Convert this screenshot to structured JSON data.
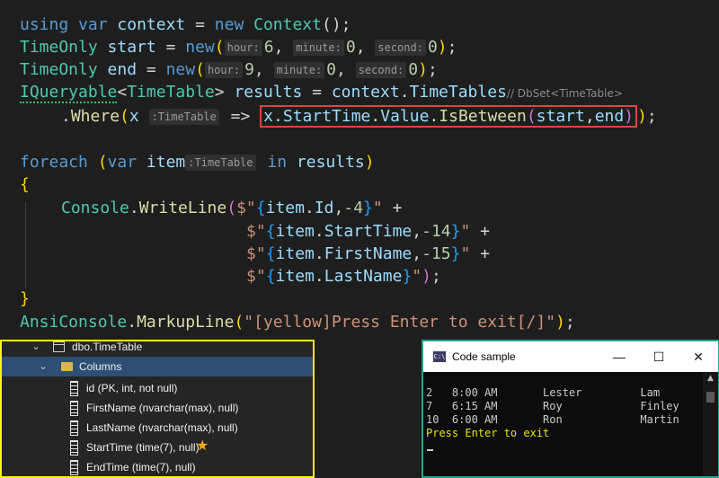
{
  "editor": {
    "l1": {
      "using": "using",
      "var": "var",
      "context": "context",
      "eq": " = ",
      "new": "new",
      "type": "Context",
      "tail": "();"
    },
    "l2": {
      "type": "TimeOnly",
      "name": "start",
      "eq": " = ",
      "new": "new",
      "open": "(",
      "h1": "hour:",
      "v1": "6",
      "comma1": ", ",
      "h2": "minute:",
      "v2": "0",
      "comma2": ", ",
      "h3": "second:",
      "v3": "0",
      "close": ")",
      "semi": ";"
    },
    "l3": {
      "type": "TimeOnly",
      "name": "end",
      "eq": " = ",
      "new": "new",
      "open": "(",
      "h1": "hour:",
      "v1": "9",
      "comma1": ", ",
      "h2": "minute:",
      "v2": "0",
      "comma2": ", ",
      "h3": "second:",
      "v3": "0",
      "close": ")",
      "semi": ";"
    },
    "l4": {
      "type": "IQueryable",
      "lt": "<",
      "gen": "TimeTable",
      "gt": ">",
      "name": "results",
      "eq": " = ",
      "ctx": "context",
      "dot": ".",
      "prop": "TimeTables",
      "comment": "// DbSet<TimeTable>"
    },
    "l5": {
      "dot": ".",
      "where": "Where",
      "open": "(",
      "x": "x",
      "hint": ":TimeTable",
      "arrow": " => ",
      "boxed_x": "x",
      "d1": ".",
      "startTime": "StartTime",
      "d2": ".",
      "value": "Value",
      "d3": ".",
      "isBetween": "IsBetween",
      "o2": "(",
      "a1": "start",
      "comma": ",",
      "a2": "end",
      "c2": ")",
      "close": ")",
      "semi": ";"
    },
    "l7": {
      "foreach": "foreach",
      "open": "(",
      "var": "var",
      "item": "item",
      "hint": ":TimeTable",
      "in": "in",
      "results": "results",
      "close": ")"
    },
    "l8": {
      "brace": "{"
    },
    "l9": {
      "console": "Console",
      "dot": ".",
      "writeLine": "WriteLine",
      "open": "(",
      "str1": "$\"",
      "ob": "{",
      "item": "item",
      "d": ".",
      "prop": "Id",
      "c": ",",
      "n": "-4",
      "cb": "}",
      "str2": "\"",
      "plus": " +"
    },
    "l10": {
      "str1": "$\"",
      "ob": "{",
      "item": "item",
      "d": ".",
      "prop": "StartTime",
      "c": ",",
      "n": "-14",
      "cb": "}",
      "str2": "\"",
      "plus": " +"
    },
    "l11": {
      "str1": "$\"",
      "ob": "{",
      "item": "item",
      "d": ".",
      "prop": "FirstName",
      "c": ",",
      "n": "-15",
      "cb": "}",
      "str2": "\"",
      "plus": " +"
    },
    "l12": {
      "str1": "$\"",
      "ob": "{",
      "item": "item",
      "d": ".",
      "prop": "LastName",
      "cb": "}",
      "str2": "\"",
      "close": ")",
      "semi": ";"
    },
    "l13": {
      "brace": "}"
    },
    "l14": {
      "ansi": "AnsiConsole",
      "dot": ".",
      "markup": "MarkupLine",
      "open": "(",
      "str": "\"[yellow]Press Enter to exit[/]\"",
      "close": ")",
      "semi": ";"
    }
  },
  "solution": {
    "table": "dbo.TimeTable",
    "folder": "Columns",
    "columns": [
      "id (PK, int, not null)",
      "FirstName (nvarchar(max), null)",
      "LastName (nvarchar(max), null)",
      "StartTime (time(7), null)",
      "EndTime (time(7), null)"
    ]
  },
  "console": {
    "title": "Code sample",
    "app_icon": "C:\\",
    "minimize": "—",
    "maximize": "☐",
    "close": "✕",
    "rows": [
      "2   8:00 AM       Lester         Lam",
      "7   6:15 AM       Roy            Finley",
      "10  6:00 AM       Ron            Martin"
    ],
    "prompt": "Press Enter to exit"
  },
  "colors": {
    "keyword": "#569cd6",
    "type": "#4ec9b0",
    "method": "#dcdcaa",
    "variable": "#9cdcfe",
    "number": "#b5cea8",
    "string": "#ce9178",
    "highlight_box": "#e5413b",
    "solution_border": "#f5f50e",
    "console_border": "#1fa58f",
    "console_yellow": "#e6e600"
  }
}
